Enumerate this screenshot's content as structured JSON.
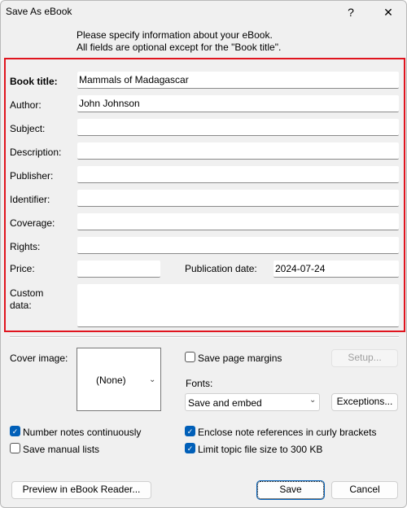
{
  "window": {
    "title": "Save As eBook",
    "help": "?",
    "close": "✕"
  },
  "intro": {
    "line1": "Please specify information about your eBook.",
    "line2": "All fields are optional except for the \"Book title\"."
  },
  "fields": {
    "book_title": {
      "label": "Book title:",
      "value": "Mammals of Madagascar"
    },
    "author": {
      "label": "Author:",
      "value": "John Johnson"
    },
    "subject": {
      "label": "Subject:",
      "value": ""
    },
    "description": {
      "label": "Description:",
      "value": ""
    },
    "publisher": {
      "label": "Publisher:",
      "value": ""
    },
    "identifier": {
      "label": "Identifier:",
      "value": ""
    },
    "coverage": {
      "label": "Coverage:",
      "value": ""
    },
    "rights": {
      "label": "Rights:",
      "value": ""
    },
    "price": {
      "label": "Price:",
      "value": ""
    },
    "publication_date": {
      "label": "Publication date:",
      "value": "2024-07-24"
    },
    "custom_data": {
      "label1": "Custom",
      "label2": "data:",
      "value": ""
    }
  },
  "cover": {
    "label": "Cover image:",
    "value": "(None)"
  },
  "options": {
    "save_page_margins": {
      "label": "Save page margins",
      "checked": false
    },
    "setup": "Setup...",
    "fonts_label": "Fonts:",
    "fonts_value": "Save and embed",
    "exceptions": "Exceptions...",
    "number_notes": {
      "label": "Number notes continuously",
      "checked": true
    },
    "save_manual_lists": {
      "label": "Save manual lists",
      "checked": false
    },
    "enclose_refs": {
      "label": "Enclose note references in curly brackets",
      "checked": true
    },
    "limit_size": {
      "label": "Limit topic file size to 300 KB",
      "checked": true
    }
  },
  "buttons": {
    "preview": "Preview in eBook Reader...",
    "save": "Save",
    "cancel": "Cancel"
  },
  "colors": {
    "highlight": "#e0141e",
    "accent": "#005fb8"
  }
}
